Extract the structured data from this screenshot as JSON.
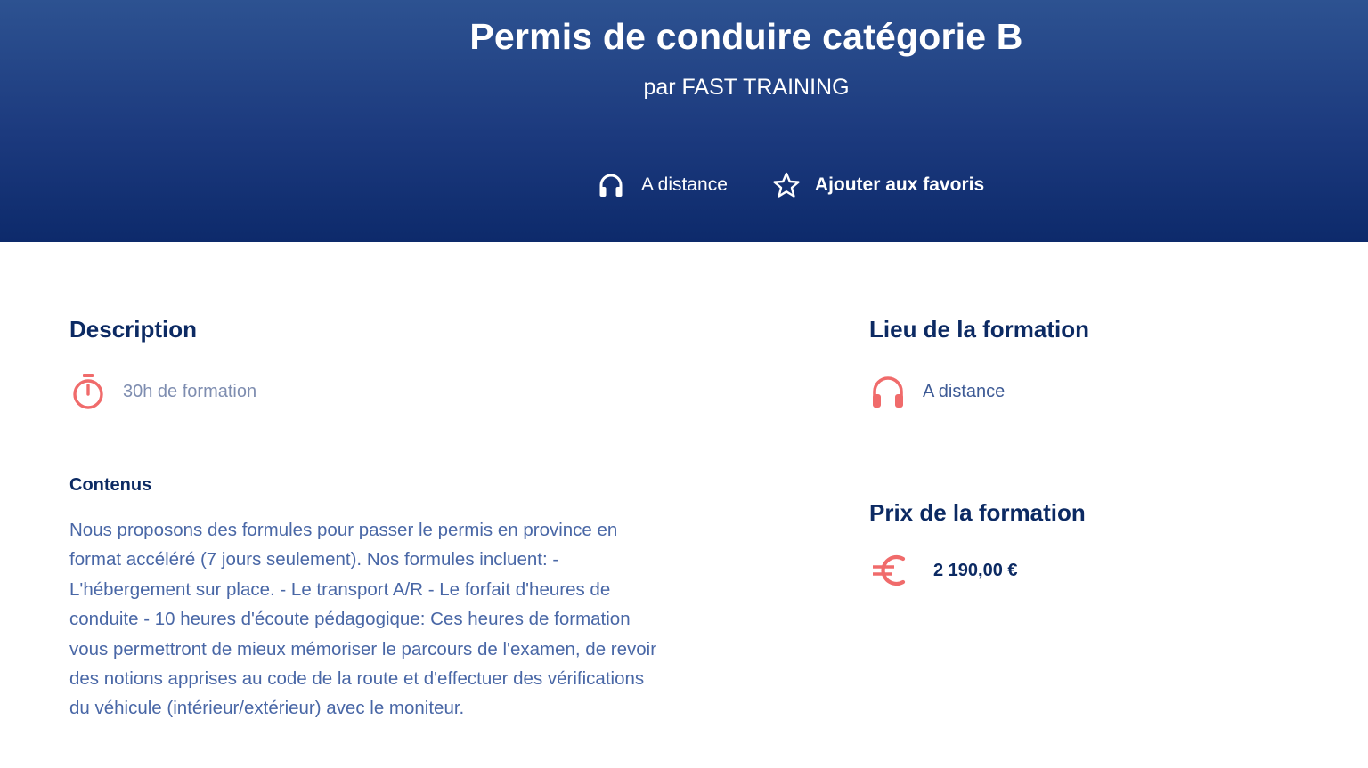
{
  "header": {
    "title": "Permis de conduire catégorie B",
    "subtitle": "par FAST TRAINING",
    "mode_label": "A distance",
    "favorite_label": "Ajouter aux favoris"
  },
  "description": {
    "title": "Description",
    "duration": "30h de formation",
    "content_heading": "Contenus",
    "content_text": "Nous proposons des formules pour passer le permis en province en format accéléré (7 jours seulement). Nos formules incluent: - L'hébergement sur place. - Le transport A/R - Le forfait d'heures de conduite - 10 heures d'écoute pédagogique: Ces heures de formation vous permettront de mieux mémoriser le parcours de l'examen, de revoir des notions apprises au code de la route et d'effectuer des vérifications du véhicule (intérieur/extérieur) avec le moniteur."
  },
  "location": {
    "title": "Lieu de la formation",
    "value": "A distance"
  },
  "price": {
    "title": "Prix de la formation",
    "value": "2 190,00 €"
  },
  "icons": {
    "headphones": "headphones-icon",
    "star": "star-icon",
    "stopwatch": "stopwatch-icon",
    "euro": "euro-icon"
  },
  "colors": {
    "header_top": "#2d5291",
    "header_bottom": "#0d2a6b",
    "heading": "#0c2a63",
    "body_text": "#4967a6",
    "accent_icon": "#f06b6b"
  }
}
